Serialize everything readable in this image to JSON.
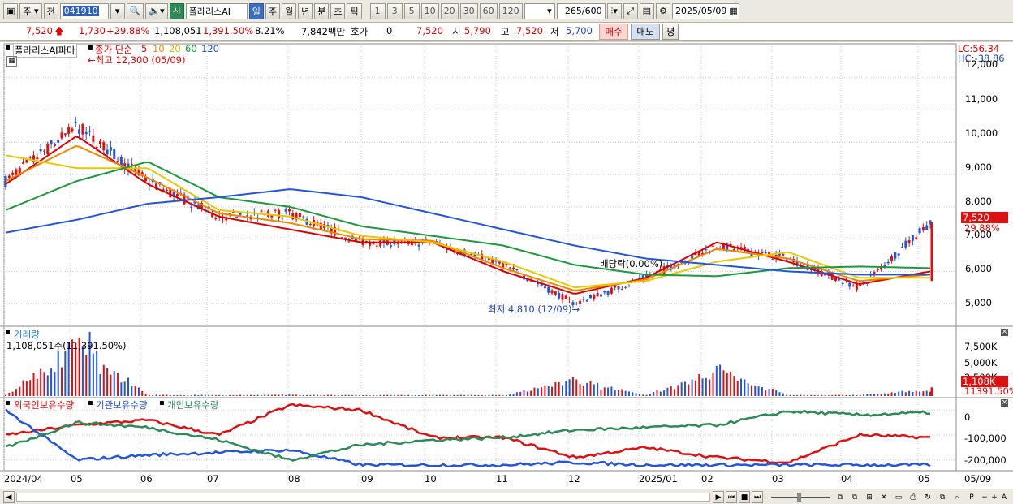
{
  "toolbar": {
    "market_label": "주",
    "range_label": "전",
    "stock_code": "041910",
    "new_badge": "신",
    "stock_name": "폴라리스AI",
    "periods": [
      "일",
      "주",
      "월",
      "년",
      "분",
      "초",
      "틱"
    ],
    "active_period": "일",
    "minutes": [
      "1",
      "3",
      "5",
      "10",
      "20",
      "30",
      "60",
      "120"
    ],
    "count_display": "265/600",
    "date": "2025/05/09"
  },
  "quote": {
    "price": "7,520",
    "change": "1,730",
    "change_pct": "+29.88%",
    "volume": "1,108,051",
    "volume_ratio": "1,391.50%",
    "turnover": "8.21%",
    "amount": "7,842백만",
    "hoga_label": "호가",
    "hoga_value": "0",
    "hoga_price": "7,520",
    "open_label": "시",
    "open": "5,790",
    "high_label": "고",
    "high": "7,520",
    "low_label": "저",
    "low": "5,700",
    "buy_label": "매수",
    "sell_label": "매도",
    "avg_label": "평"
  },
  "price_panel": {
    "stock_title": "폴라리스AI파마",
    "legend_prefix": "종가 단순",
    "ma_periods": [
      "5",
      "10",
      "20",
      "60",
      "120"
    ],
    "ma_colors": [
      "#dd0000",
      "#ee8800",
      "#e8c800",
      "#1a9a3a",
      "#2255dd"
    ],
    "high_marker": "최고 12,300 (05/09)",
    "low_marker": "최저 4,810 (12/09)",
    "event_marker": "배당락(0.00%)",
    "lc": "LC:56.34",
    "hc": "HC:-38.86",
    "last_price": "7,520",
    "last_pct": "29.88%",
    "y_ticks": [
      "12,000",
      "11,000",
      "10,000",
      "9,000",
      "8,000",
      "7,000",
      "6,000",
      "5,000"
    ]
  },
  "volume_panel": {
    "title": "거래량",
    "value": "1,108,051주(11,391.50%)",
    "y_ticks": [
      "7,500K",
      "5,000K",
      "2,500K"
    ],
    "last": "1,108K",
    "last_pct": "11391.50%"
  },
  "holdings_panel": {
    "series": [
      "외국인보유수량",
      "기관보유수량",
      "개인보유수량"
    ],
    "colors": [
      "#dd1111",
      "#2255dd",
      "#2e8b57"
    ],
    "y_ticks": [
      "0",
      "-100,000",
      "-200,000"
    ]
  },
  "x_axis": [
    "2024/04",
    "05",
    "06",
    "07",
    "08",
    "09",
    "10",
    "11",
    "12",
    "2025/01",
    "02",
    "03",
    "04",
    "05"
  ],
  "x_right": "05/09",
  "chart_data": [
    {
      "type": "candlestick",
      "title": "폴라리스AI파마",
      "ylim": [
        4500,
        12500
      ],
      "x": [
        "2024/04",
        "05",
        "06",
        "07",
        "08",
        "09",
        "10",
        "11",
        "12",
        "2025/01",
        "02",
        "03",
        "04",
        "05/09"
      ],
      "close_approx": [
        8800,
        10500,
        8800,
        7700,
        7800,
        6900,
        6900,
        6200,
        5000,
        5800,
        6800,
        6400,
        5500,
        7520
      ],
      "ma_series": [
        {
          "name": "5",
          "values": [
            8700,
            10200,
            8700,
            7700,
            7300,
            6900,
            6900,
            6000,
            5300,
            5800,
            6900,
            6300,
            5600,
            6000
          ]
        },
        {
          "name": "10",
          "values": [
            8800,
            9900,
            8900,
            7800,
            7500,
            7000,
            6950,
            6100,
            5400,
            5750,
            6700,
            6400,
            5700,
            5900
          ]
        },
        {
          "name": "20",
          "values": [
            9600,
            9200,
            9200,
            7900,
            7700,
            7100,
            6900,
            6300,
            5500,
            5700,
            6300,
            6600,
            5800,
            5800
          ]
        },
        {
          "name": "60",
          "values": [
            7900,
            8800,
            9400,
            8300,
            8000,
            7400,
            7100,
            6800,
            6200,
            5900,
            5850,
            6100,
            6150,
            6100
          ]
        },
        {
          "name": "120",
          "values": [
            7200,
            7600,
            8100,
            8300,
            8550,
            8300,
            7800,
            7300,
            6800,
            6400,
            6200,
            6000,
            5900,
            5900
          ]
        }
      ]
    },
    {
      "type": "bar",
      "title": "거래량",
      "ylim": [
        0,
        8500000
      ],
      "x": [
        "2024/04",
        "05",
        "06",
        "07",
        "08",
        "09",
        "10",
        "11",
        "12",
        "2025/01",
        "02",
        "03",
        "04",
        "05/09"
      ],
      "values": [
        150000,
        8200000,
        200000,
        150000,
        200000,
        150000,
        150000,
        150000,
        2500000,
        150000,
        4000000,
        150000,
        150000,
        1108051
      ]
    },
    {
      "type": "line",
      "ylim": [
        -230000,
        30000
      ],
      "x": [
        "2024/04",
        "05",
        "06",
        "07",
        "08",
        "09",
        "10",
        "11",
        "12",
        "2025/01",
        "02",
        "03",
        "04",
        "05/09"
      ],
      "series": [
        {
          "name": "외국인보유수량",
          "values": [
            -100000,
            -60000,
            -40000,
            -100000,
            20000,
            0,
            -110000,
            -110000,
            -190000,
            -150000,
            -190000,
            -210000,
            -100000,
            -110000
          ]
        },
        {
          "name": "기관보유수량",
          "values": [
            0,
            -200000,
            -180000,
            -170000,
            -160000,
            -220000,
            -220000,
            -220000,
            -210000,
            -220000,
            -220000,
            -220000,
            -220000,
            -220000
          ]
        },
        {
          "name": "개인보유수량",
          "values": [
            -150000,
            -50000,
            -70000,
            -120000,
            -200000,
            -140000,
            -120000,
            -110000,
            -80000,
            -70000,
            -60000,
            -5000,
            -20000,
            -10000
          ]
        }
      ]
    }
  ]
}
